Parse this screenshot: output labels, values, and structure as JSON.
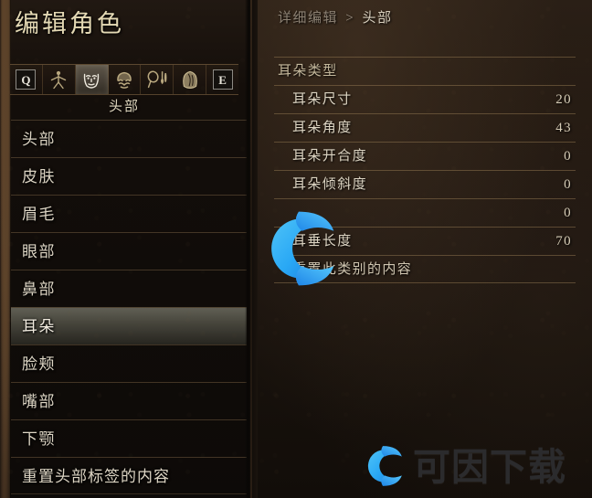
{
  "window": {
    "title": "编辑角色"
  },
  "colors": {
    "panel_bg_left": "#110d0a",
    "panel_bg_right": "#241a12",
    "text_primary": "#ddd5c4",
    "text_title": "#e4d9b4",
    "divider_line": "#9c8058",
    "selection_highlight": "#7f7f71",
    "watermark_blue": "#29a8f5",
    "watermark_dark": "#2b2b2d"
  },
  "icon_strip": {
    "label": "头部",
    "cells": [
      {
        "type": "keycap",
        "label": "Q",
        "icon": "key-q",
        "selected": false
      },
      {
        "type": "icon",
        "label": "体型",
        "icon": "body-pose-icon",
        "selected": false
      },
      {
        "type": "icon",
        "label": "头部",
        "icon": "face-icon",
        "selected": true
      },
      {
        "type": "icon",
        "label": "发型",
        "icon": "hair-icon",
        "selected": false
      },
      {
        "type": "icon",
        "label": "妆容",
        "icon": "makeup-icon",
        "selected": false
      },
      {
        "type": "icon",
        "label": "身体",
        "icon": "torso-icon",
        "selected": false
      },
      {
        "type": "keycap",
        "label": "E",
        "icon": "key-e",
        "selected": false
      }
    ]
  },
  "sidebar": {
    "items": [
      {
        "label": "头部",
        "selected": false
      },
      {
        "label": "皮肤",
        "selected": false
      },
      {
        "label": "眉毛",
        "selected": false
      },
      {
        "label": "眼部",
        "selected": false
      },
      {
        "label": "鼻部",
        "selected": false
      },
      {
        "label": "耳朵",
        "selected": true
      },
      {
        "label": "脸颊",
        "selected": false
      },
      {
        "label": "嘴部",
        "selected": false
      },
      {
        "label": "下颚",
        "selected": false
      },
      {
        "label": "重置头部标签的内容",
        "selected": false
      }
    ]
  },
  "detail": {
    "breadcrumb": {
      "root": "详细编辑",
      "separator": ">",
      "leaf": "头部"
    },
    "rows": [
      {
        "label": "耳朵类型",
        "value": "",
        "kind": "header"
      },
      {
        "label": "耳朵尺寸",
        "value": "20",
        "kind": "sub"
      },
      {
        "label": "耳朵角度",
        "value": "43",
        "kind": "sub"
      },
      {
        "label": "耳朵开合度",
        "value": "0",
        "kind": "sub"
      },
      {
        "label": "耳朵倾斜度",
        "value": "0",
        "kind": "sub"
      },
      {
        "label": "",
        "value": "0",
        "kind": "sub"
      },
      {
        "label": "耳垂长度",
        "value": "70",
        "kind": "sub"
      },
      {
        "label": "重置此类别的内容",
        "value": "",
        "kind": "reset"
      }
    ]
  },
  "watermark": {
    "brand_text": "可因下载",
    "logo_name": "c-logo"
  }
}
